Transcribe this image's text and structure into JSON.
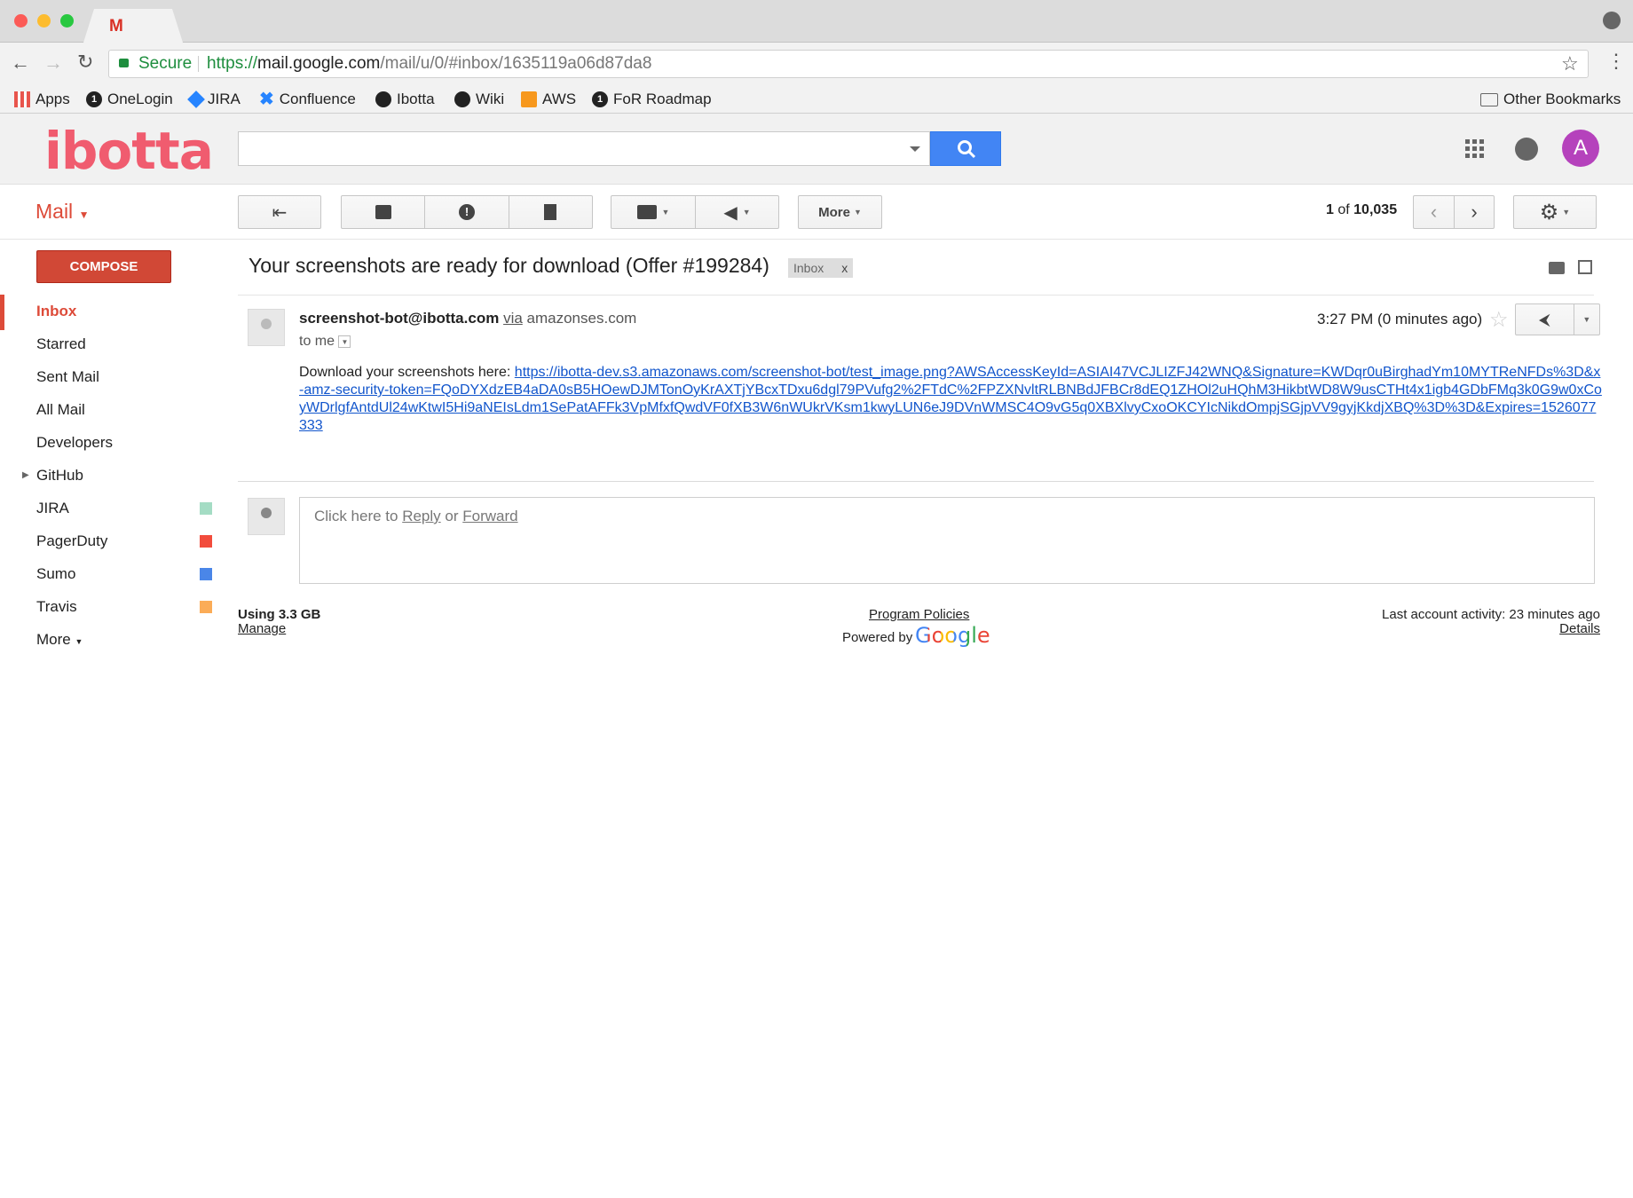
{
  "browser": {
    "address": {
      "secure_label": "Secure",
      "scheme": "https://",
      "host": "mail.google.com",
      "path": "/mail/u/0/#inbox/1635119a06d87da8"
    },
    "tabs": [
      {
        "icon": "M"
      },
      {
        "icon": "11"
      }
    ],
    "bookmarks": [
      {
        "label": "Apps"
      },
      {
        "label": "OneLogin"
      },
      {
        "label": "JIRA"
      },
      {
        "label": "Confluence"
      },
      {
        "label": "Ibotta"
      },
      {
        "label": "Wiki"
      },
      {
        "label": "AWS"
      },
      {
        "label": "FoR Roadmap"
      }
    ],
    "other_bookmarks": "Other Bookmarks"
  },
  "header": {
    "logo": "ibotta",
    "avatar_letter": "A"
  },
  "actions": {
    "mail_label": "Mail",
    "more_label": "More",
    "count_current": "1",
    "count_of": "of",
    "count_total": "10,035"
  },
  "sidebar": {
    "compose": "COMPOSE",
    "items": [
      {
        "label": "Inbox",
        "active": true
      },
      {
        "label": "Starred"
      },
      {
        "label": "Sent Mail"
      },
      {
        "label": "All Mail"
      },
      {
        "label": "Developers"
      },
      {
        "label": "GitHub",
        "expandable": true
      },
      {
        "label": "JIRA",
        "color": "#a4dcc4"
      },
      {
        "label": "PagerDuty",
        "color": "#f24c3c"
      },
      {
        "label": "Sumo",
        "color": "#4a86e8"
      },
      {
        "label": "Travis",
        "color": "#fbac57"
      },
      {
        "label": "More"
      }
    ]
  },
  "email": {
    "subject": "Your screenshots are ready for download (Offer #199284)",
    "label_badge": "Inbox",
    "label_remove": "x",
    "sender": "screenshot-bot@ibotta.com",
    "via": "via",
    "via_domain": "amazonses.com",
    "to": "to me",
    "time": "3:27 PM (0 minutes ago)",
    "body_prefix": "Download your screenshots here: ",
    "link": "https://ibotta-dev.s3.amazonaws.com/screenshot-bot/test_image.png?AWSAccessKeyId=ASIAI47VCJLIZFJ42WNQ&Signature=KWDqr0uBirghadYm10MYTReNFDs%3D&x-amz-security-token=FQoDYXdzEB4aDA0sB5HOewDJMTonOyKrAXTjYBcxTDxu6dgl79PVufg2%2FTdC%2FPZXNvltRLBNBdJFBCr8dEQ1ZHOl2uHQhM3HikbtWD8W9usCTHt4x1igb4GDbFMq3k0G9w0xCoyWDrlgfAntdUl24wKtwI5Hi9aNEIsLdm1SePatAFFk3VpMfxfQwdVF0fXB3W6nWUkrVKsm1kwyLUN6eJ9DVnWMSC4O9vG5q0XBXlvyCxoOKCYIcNikdOmpjSGjpVV9gyjKkdjXBQ%3D%3D&Expires=1526077333"
  },
  "reply": {
    "prefix": "Click here to ",
    "reply": "Reply",
    "or": " or ",
    "forward": "Forward"
  },
  "footer": {
    "storage": "Using 3.3 GB",
    "manage": "Manage",
    "policies": "Program Policies",
    "powered_by": "Powered by",
    "google": "Google",
    "activity": "Last account activity: 23 minutes ago",
    "details": "Details"
  }
}
